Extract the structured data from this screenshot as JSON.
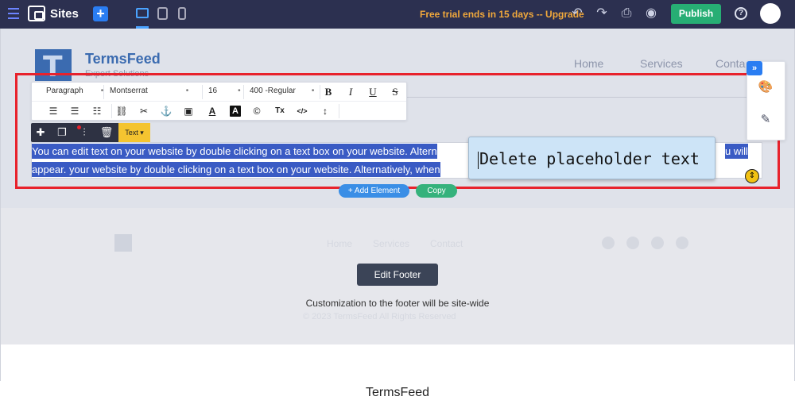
{
  "topbar": {
    "app_title": "Sites",
    "trial_text": "Free trial ends in 15 days -- Upgrade",
    "publish_label": "Publish",
    "help_glyph": "?",
    "add_glyph": "+",
    "icons": [
      "menu-icon",
      "sites-logo-icon",
      "add-icon",
      "desktop-icon",
      "tablet-icon",
      "mobile-icon",
      "undo-icon",
      "redo-icon",
      "save-icon",
      "preview-icon",
      "help-icon",
      "avatar"
    ]
  },
  "site_header": {
    "brand_name": "TermsFeed",
    "brand_tagline": "Expert Solutions",
    "nav": [
      "Home",
      "Services",
      "Conta"
    ]
  },
  "format_toolbar": {
    "block_type": "Paragraph",
    "font_family": "Montserrat",
    "font_size": "16",
    "font_weight": "400 -Regular",
    "bold": "B",
    "italic": "I",
    "underline": "U",
    "strike": "S",
    "text_color": "A",
    "bg_color": "A",
    "copyright": "©",
    "clear_format": "Tx",
    "code": "</>"
  },
  "element_toolbar": {
    "type_label": "Text",
    "icons": [
      "plus-icon",
      "duplicate-icon",
      "settings-sliders-icon",
      "trash-icon"
    ]
  },
  "selected_text": {
    "line1": "You can edit text on your website by double clicking on a text box on your website. Altern",
    "line1_tail": "u will",
    "line2": "appear. your website by double clicking on a text box on your website. Alternatively, when"
  },
  "tooltip": {
    "text": "Delete placeholder text"
  },
  "canvas_actions": {
    "add_element": "+ Add Element",
    "copy": "Copy"
  },
  "side_panel": {
    "collapse_glyph": "»",
    "icons": [
      "palette-icon",
      "edit-icon"
    ]
  },
  "footer": {
    "edit_footer_label": "Edit Footer",
    "note": "Customization to the footer will be site-wide",
    "faint_nav": [
      "Home",
      "Services",
      "Contact"
    ],
    "faint_copyright": "© 2023 TermsFeed All Rights Reserved"
  },
  "caption": "TermsFeed",
  "colors": {
    "topbar_bg": "#2c3050",
    "accent_blue": "#2a7df2",
    "publish_green": "#27ae74",
    "trial_orange": "#f2a93b",
    "selection_blue": "#3a5bc4",
    "red_frame": "#e8222c",
    "tooltip_bg": "#cde4f7"
  }
}
